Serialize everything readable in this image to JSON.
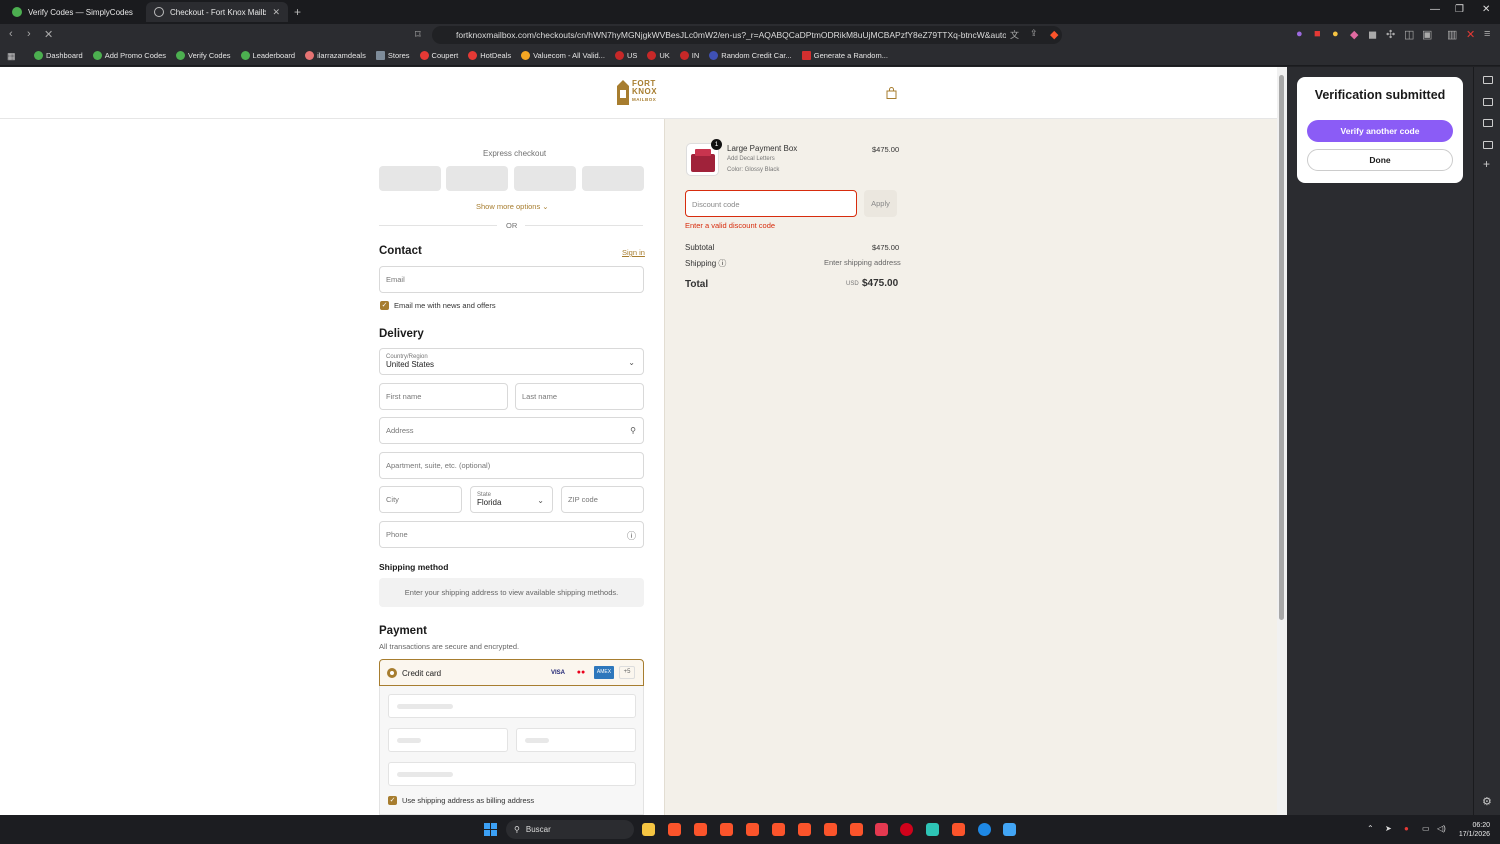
{
  "tabs": [
    {
      "title": "Verify Codes — SimplyCodes",
      "active": false
    },
    {
      "title": "Checkout - Fort Knox Mailbox Si",
      "active": true
    }
  ],
  "address_bar": {
    "url": "fortknoxmailbox.com/checkouts/cn/hWN7hyMGNjgkWVBesJLc0mW2/en-us?_r=AQABQCaDPtmODRikM8uUjMCBAPzfY8eZ79TTXq-btncW&auto_red..."
  },
  "bookmarks": [
    {
      "label": "Dashboard",
      "color": "#4caf50"
    },
    {
      "label": "Add Promo Codes",
      "color": "#4caf50"
    },
    {
      "label": "Verify Codes",
      "color": "#4caf50"
    },
    {
      "label": "Leaderboard",
      "color": "#4caf50"
    },
    {
      "label": "ilarrazamdeals",
      "color": "#e57373"
    },
    {
      "label": "Stores",
      "color": "#7e8c9a"
    },
    {
      "label": "Coupert",
      "color": "#e53935"
    },
    {
      "label": "HotDeals",
      "color": "#e53935"
    },
    {
      "label": "Valuecom - All Valid...",
      "color": "#f5a623"
    },
    {
      "label": "US",
      "color": "#c62828"
    },
    {
      "label": "UK",
      "color": "#c62828"
    },
    {
      "label": "IN",
      "color": "#c62828"
    },
    {
      "label": "Random Credit Car...",
      "color": "#3f51b5"
    },
    {
      "label": "Generate a Random...",
      "color": "#d32f2f"
    }
  ],
  "checkout": {
    "logo_top": "FORT",
    "logo_mid": "KNOX",
    "logo_bot": "MAILBOX",
    "express_checkout": "Express checkout",
    "show_more": "Show more options ⌄",
    "or": "OR",
    "contact_heading": "Contact",
    "sign_in": "Sign in",
    "email_placeholder": "Email",
    "email_news": "Email me with news and offers",
    "delivery_heading": "Delivery",
    "country_label": "Country/Region",
    "country_value": "United States",
    "first_name": "First name",
    "last_name": "Last name",
    "address": "Address",
    "apartment": "Apartment, suite, etc. (optional)",
    "city": "City",
    "state_label": "State",
    "state_value": "Florida",
    "zip": "ZIP code",
    "phone": "Phone",
    "shipping_method_heading": "Shipping method",
    "shipping_method_note": "Enter your shipping address to view available shipping methods.",
    "payment_heading": "Payment",
    "payment_note": "All transactions are secure and encrypted.",
    "credit_card": "Credit card",
    "card_brands": [
      "VISA",
      "●●",
      "AMEX",
      "+5"
    ],
    "use_shipping": "Use shipping address as billing address"
  },
  "summary": {
    "qty": "1",
    "product_name": "Large Payment Box",
    "product_opt1": "Add Decal Letters",
    "product_opt2": "Color: Glossy Black",
    "product_price": "$475.00",
    "discount_placeholder": "Discount code",
    "apply": "Apply",
    "discount_error": "Enter a valid discount code",
    "subtotal_label": "Subtotal",
    "subtotal_value": "$475.00",
    "shipping_label": "Shipping ⓘ",
    "shipping_value": "Enter shipping address",
    "total_label": "Total",
    "currency": "USD",
    "total_value": "$475.00"
  },
  "extension_panel": {
    "title": "Verification submitted",
    "verify_another": "Verify another code",
    "done": "Done"
  },
  "taskbar": {
    "search": "Buscar",
    "time": "06:20",
    "date": "17/1/2026"
  },
  "colors": {
    "brand_gold": "#a77d2f",
    "error_red": "#d72c0d",
    "extension_purple": "#8b5cf6"
  }
}
